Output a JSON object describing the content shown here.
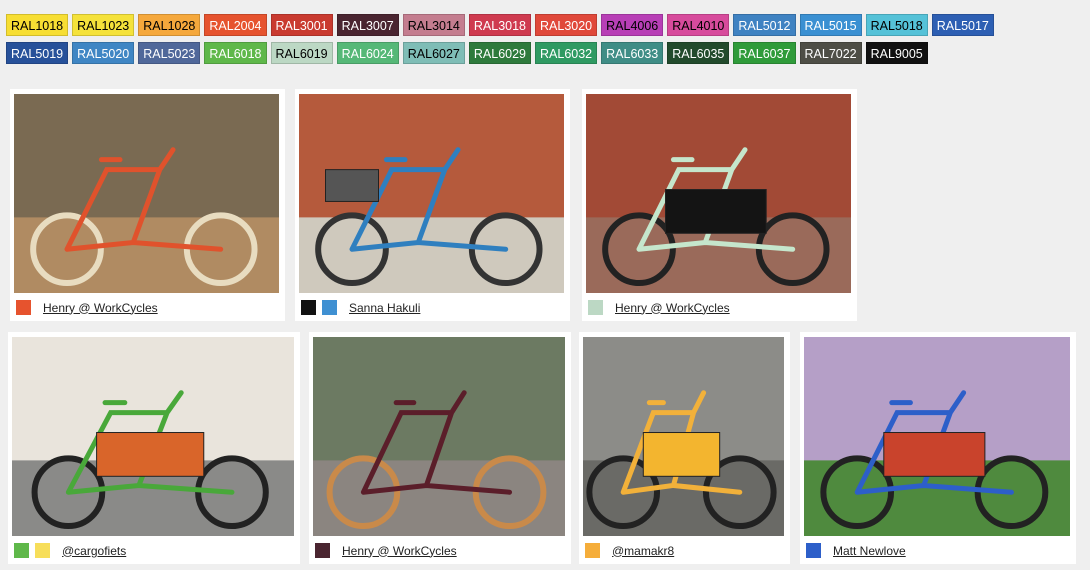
{
  "colors": [
    {
      "code": "RAL1018",
      "hex": "#f7de33",
      "text": "#000"
    },
    {
      "code": "RAL1023",
      "hex": "#f5e23a",
      "text": "#000"
    },
    {
      "code": "RAL1028",
      "hex": "#f5a83c",
      "text": "#000"
    },
    {
      "code": "RAL2004",
      "hex": "#e6532e",
      "text": "#fff"
    },
    {
      "code": "RAL3001",
      "hex": "#c93a2f",
      "text": "#fff"
    },
    {
      "code": "RAL3007",
      "hex": "#4a2530",
      "text": "#fff"
    },
    {
      "code": "RAL3014",
      "hex": "#c47d8f",
      "text": "#000"
    },
    {
      "code": "RAL3018",
      "hex": "#cf3a4f",
      "text": "#fff"
    },
    {
      "code": "RAL3020",
      "hex": "#e0483a",
      "text": "#fff"
    },
    {
      "code": "RAL4006",
      "hex": "#b83fb6",
      "text": "#000"
    },
    {
      "code": "RAL4010",
      "hex": "#d74b9c",
      "text": "#000"
    },
    {
      "code": "RAL5012",
      "hex": "#3f82c2",
      "text": "#fff"
    },
    {
      "code": "RAL5015",
      "hex": "#3a90d2",
      "text": "#fff"
    },
    {
      "code": "RAL5018",
      "hex": "#55c2d8",
      "text": "#000"
    },
    {
      "code": "RAL5017",
      "hex": "#2d5fb3",
      "text": "#fff"
    },
    {
      "code": "RAL5019",
      "hex": "#27519a",
      "text": "#fff"
    },
    {
      "code": "RAL5020",
      "hex": "#3f86c4",
      "text": "#fff"
    },
    {
      "code": "RAL5023",
      "hex": "#50689a",
      "text": "#fff"
    },
    {
      "code": "RAL6018",
      "hex": "#5fb84a",
      "text": "#fff"
    },
    {
      "code": "RAL6019",
      "hex": "#bcd8c4",
      "text": "#000"
    },
    {
      "code": "RAL6024",
      "hex": "#56b877",
      "text": "#fff"
    },
    {
      "code": "RAL6027",
      "hex": "#7fbdb6",
      "text": "#000"
    },
    {
      "code": "RAL6029",
      "hex": "#2e7a3c",
      "text": "#fff"
    },
    {
      "code": "RAL6032",
      "hex": "#2f9a62",
      "text": "#fff"
    },
    {
      "code": "RAL6033",
      "hex": "#3f8d86",
      "text": "#fff"
    },
    {
      "code": "RAL6035",
      "hex": "#224a2c",
      "text": "#fff"
    },
    {
      "code": "RAL6037",
      "hex": "#2f9b3a",
      "text": "#fff"
    },
    {
      "code": "RAL7022",
      "hex": "#4e4e46",
      "text": "#fff"
    },
    {
      "code": "RAL9005",
      "hex": "#111111",
      "text": "#fff"
    }
  ],
  "cards": [
    {
      "author": "Henry @ WorkCycles",
      "swatches": [
        "#e6532e"
      ],
      "frame": "#e0522c",
      "bg": "#7a6a52",
      "ground": "#b08b62",
      "cargo": "none",
      "tire": "#e8dcc0"
    },
    {
      "author": "Sanna Hakuli",
      "swatches": [
        "#111111",
        "#3f90d2"
      ],
      "frame": "#2f7fbf",
      "bg": "#b55a3c",
      "ground": "#cfc9bd",
      "cargo": "basket",
      "tire": "#333"
    },
    {
      "author": "Henry @ WorkCycles",
      "swatches": [
        "#bcd8c4"
      ],
      "frame": "#c5e6cc",
      "bg": "#a24a36",
      "ground": "#9a6a5a",
      "cargo": "box-black",
      "tire": "#222"
    },
    {
      "author": "@cargofiets",
      "swatches": [
        "#5fb84a",
        "#f7de5a"
      ],
      "frame": "#49a83a",
      "bg": "#e9e4dc",
      "ground": "#8a8a88",
      "cargo": "box-orange",
      "tire": "#222"
    },
    {
      "author": "Henry @ WorkCycles",
      "swatches": [
        "#4a2530"
      ],
      "frame": "#5b1e2a",
      "bg": "#6c7a62",
      "ground": "#8b8580",
      "cargo": "none",
      "tire": "#c98a4a"
    },
    {
      "author": "@mamakr8",
      "swatches": [
        "#f5ad3a"
      ],
      "frame": "#f2b13a",
      "bg": "#8c8c88",
      "ground": "#6a6a66",
      "cargo": "box-yellow",
      "tire": "#222"
    },
    {
      "author": "Matt Newlove",
      "swatches": [
        "#2d5fc9"
      ],
      "frame": "#2d5fc9",
      "bg": "#b59fc7",
      "ground": "#4f8a3e",
      "cargo": "box-red",
      "tire": "#222"
    }
  ]
}
